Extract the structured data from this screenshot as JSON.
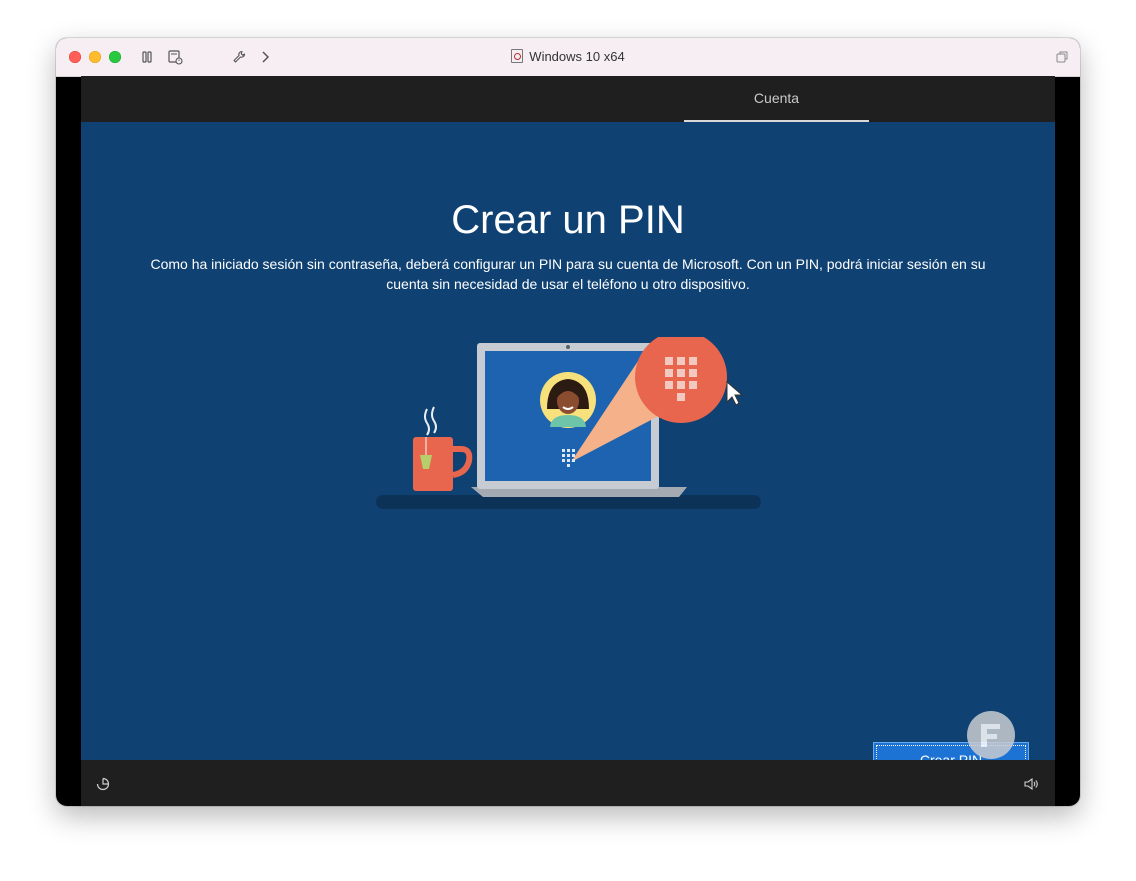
{
  "window": {
    "title": "Windows 10 x64"
  },
  "oobe": {
    "tab": "Cuenta",
    "heading": "Crear un PIN",
    "description": "Como ha iniciado sesión sin contraseña, deberá configurar un PIN para su cuenta de Microsoft. Con un PIN, podrá iniciar sesión en su cuenta sin necesidad de usar el teléfono u otro dispositivo.",
    "primary_button": "Crear PIN"
  },
  "icons": {
    "toolbar": [
      "pause-icon",
      "snapshot-icon",
      "wrench-icon",
      "chevron-right-icon",
      "restore-icon"
    ],
    "bottom": [
      "accessibility-icon",
      "volume-icon"
    ]
  },
  "colors": {
    "oobe_background": "#0f4172",
    "button": "#1c73d4",
    "bars": "#1f1f1f",
    "illustration_accent": "#e8664e"
  }
}
